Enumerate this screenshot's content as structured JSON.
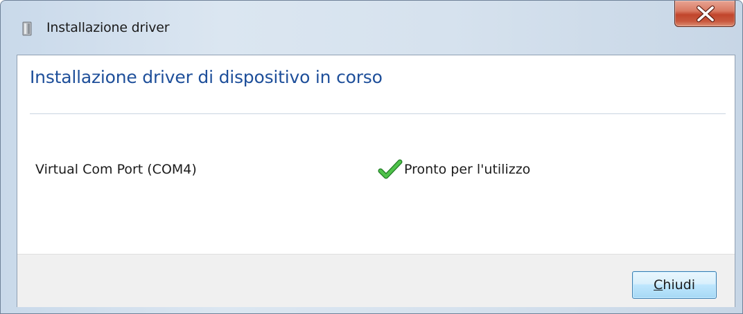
{
  "window": {
    "title": "Installazione driver",
    "title_icon": "driver-installer-icon",
    "close_icon": "close-icon"
  },
  "content": {
    "heading": "Installazione driver di dispositivo in corso",
    "devices": [
      {
        "name": "Virtual Com Port (COM4)",
        "status": "Pronto per l'utilizzo",
        "status_icon": "check-icon",
        "status_color": "#3aa23a"
      }
    ]
  },
  "footer": {
    "close_button": {
      "accelerator": "C",
      "rest": "hiudi"
    }
  },
  "colors": {
    "heading": "#1e4f9a",
    "close_button_red": "#c1452c",
    "footer_bg": "#f0f0f0"
  }
}
